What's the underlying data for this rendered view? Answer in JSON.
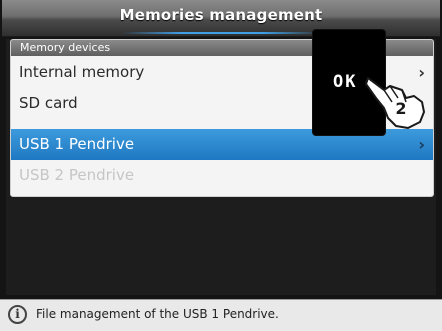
{
  "window": {
    "title": "Memories management"
  },
  "list": {
    "header": "Memory devices",
    "items": [
      {
        "label": "Internal memory",
        "chevron": "›"
      },
      {
        "label": "SD card",
        "chevron": ""
      },
      {
        "label": "USB 1 Pendrive",
        "chevron": "›"
      },
      {
        "label": "USB 2 Pendrive",
        "chevron": ""
      }
    ]
  },
  "ok_button": {
    "label": "OK"
  },
  "callout": {
    "step": "2"
  },
  "status": {
    "text": "File management of the USB 1 Pendrive."
  },
  "icons": {
    "info": "info-icon",
    "hand": "pointing-hand-icon",
    "chevron": "chevron-right-icon"
  },
  "colors": {
    "selection": "#2585cf",
    "background": "#141414"
  }
}
